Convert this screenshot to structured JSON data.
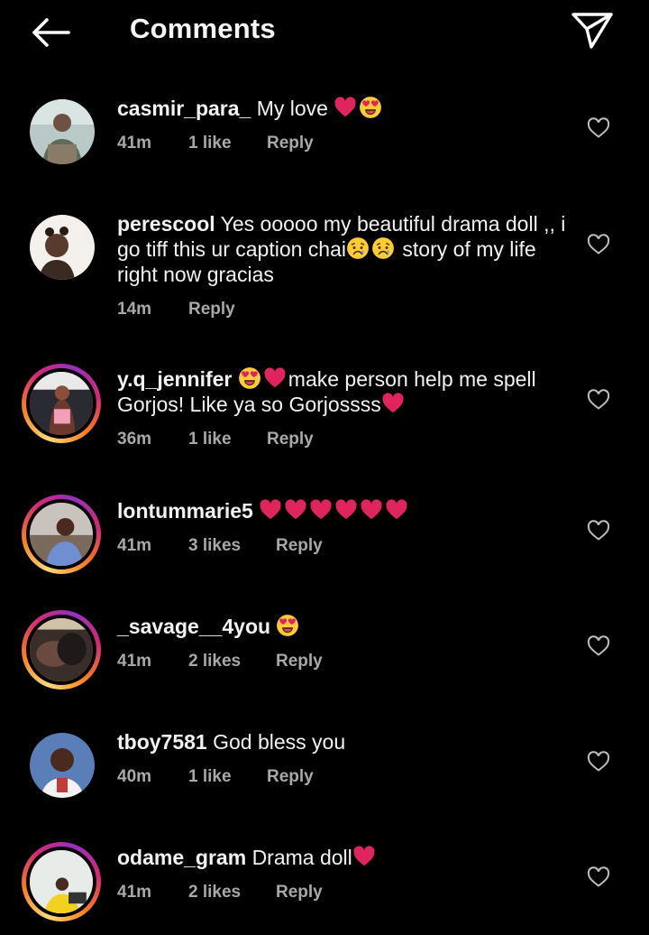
{
  "header": {
    "title": "Comments"
  },
  "comments": [
    {
      "user": "casmir_para_",
      "text": "My love",
      "emoji_after": [
        "red-heart",
        "heart-eyes"
      ],
      "time": "41m",
      "likes": "1 like",
      "reply": "Reply"
    },
    {
      "user": "perescool",
      "text_parts": [
        "Yes ooooo my beautiful drama doll ,, i go tiff this ur caption chai",
        "story of my life right now gracias"
      ],
      "emoji_mid": [
        "sad-face",
        "sad-face"
      ],
      "time": "14m",
      "likes": "",
      "reply": "Reply"
    },
    {
      "user": "y.q_jennifer",
      "text_parts": [
        "make person help me spell Gorjos! Like ya so Gorjossss"
      ],
      "emoji_lead": [
        "heart-eyes",
        "red-heart"
      ],
      "emoji_after": [
        "red-heart"
      ],
      "time": "36m",
      "likes": "1 like",
      "reply": "Reply"
    },
    {
      "user": "lontummarie5",
      "text": "",
      "emoji_after": [
        "red-heart",
        "red-heart",
        "red-heart",
        "red-heart",
        "red-heart",
        "red-heart"
      ],
      "time": "41m",
      "likes": "3 likes",
      "reply": "Reply"
    },
    {
      "user": "_savage__4you",
      "text": "",
      "emoji_after": [
        "heart-eyes"
      ],
      "time": "41m",
      "likes": "2 likes",
      "reply": "Reply"
    },
    {
      "user": "tboy7581",
      "text": "God bless you",
      "time": "40m",
      "likes": "1 like",
      "reply": "Reply"
    },
    {
      "user": "odame_gram",
      "text": "Drama doll",
      "emoji_after": [
        "red-heart"
      ],
      "time": "41m",
      "likes": "2 likes",
      "reply": "Reply"
    }
  ],
  "icons": {
    "back": "back-arrow-icon",
    "send": "send-icon",
    "like": "heart-outline-icon"
  },
  "colors": {
    "background": "#000000",
    "text": "#f2f2f2",
    "meta": "#a8a8a8",
    "heart": "#e0245e"
  }
}
